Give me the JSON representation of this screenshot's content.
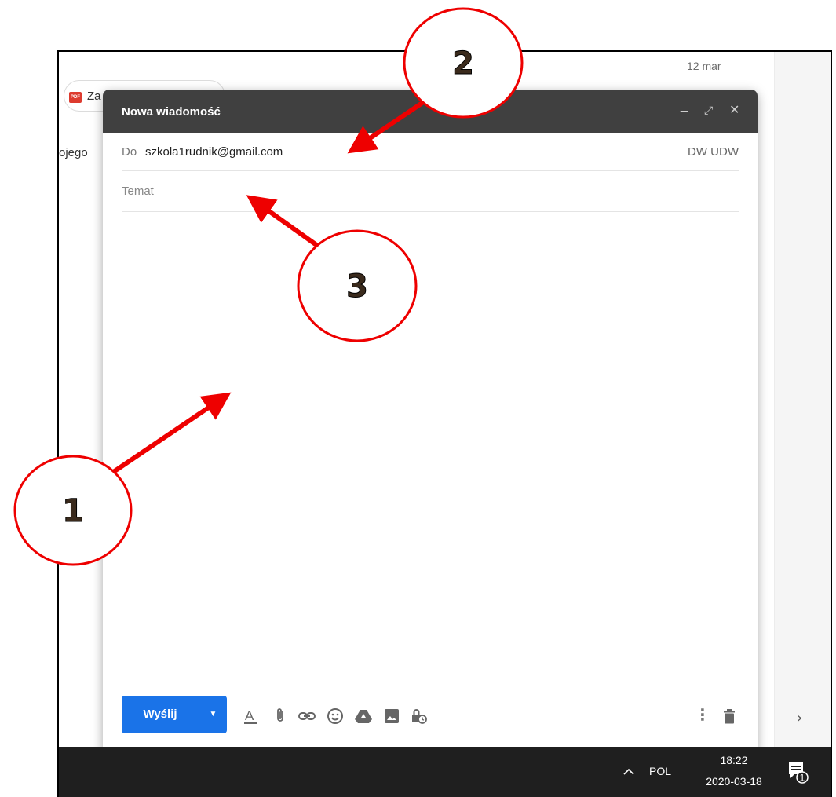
{
  "background": {
    "date": "12 mar",
    "attachment_chip": "Za",
    "attachment_type": "PDF",
    "snippet": "ojego"
  },
  "compose": {
    "title": "Nowa wiadomość",
    "to_label": "Do",
    "to_value": "szkola1rudnik@gmail.com",
    "cc_bcc": "DW UDW",
    "subject_placeholder": "Temat",
    "send_label": "Wyślij",
    "toolbar_icons": [
      "format-text-icon",
      "attach-icon",
      "link-icon",
      "emoji-icon",
      "drive-icon",
      "image-icon",
      "confidential-icon",
      "more-options-icon",
      "delete-icon"
    ],
    "accent": "#1a73e8",
    "header_color": "#404040"
  },
  "taskbar": {
    "language": "POL",
    "time": "18:22",
    "date": "2020-03-18",
    "notification_count": "1"
  },
  "annotations": {
    "labels": [
      "1",
      "2",
      "3"
    ],
    "color": "#ee0000"
  }
}
